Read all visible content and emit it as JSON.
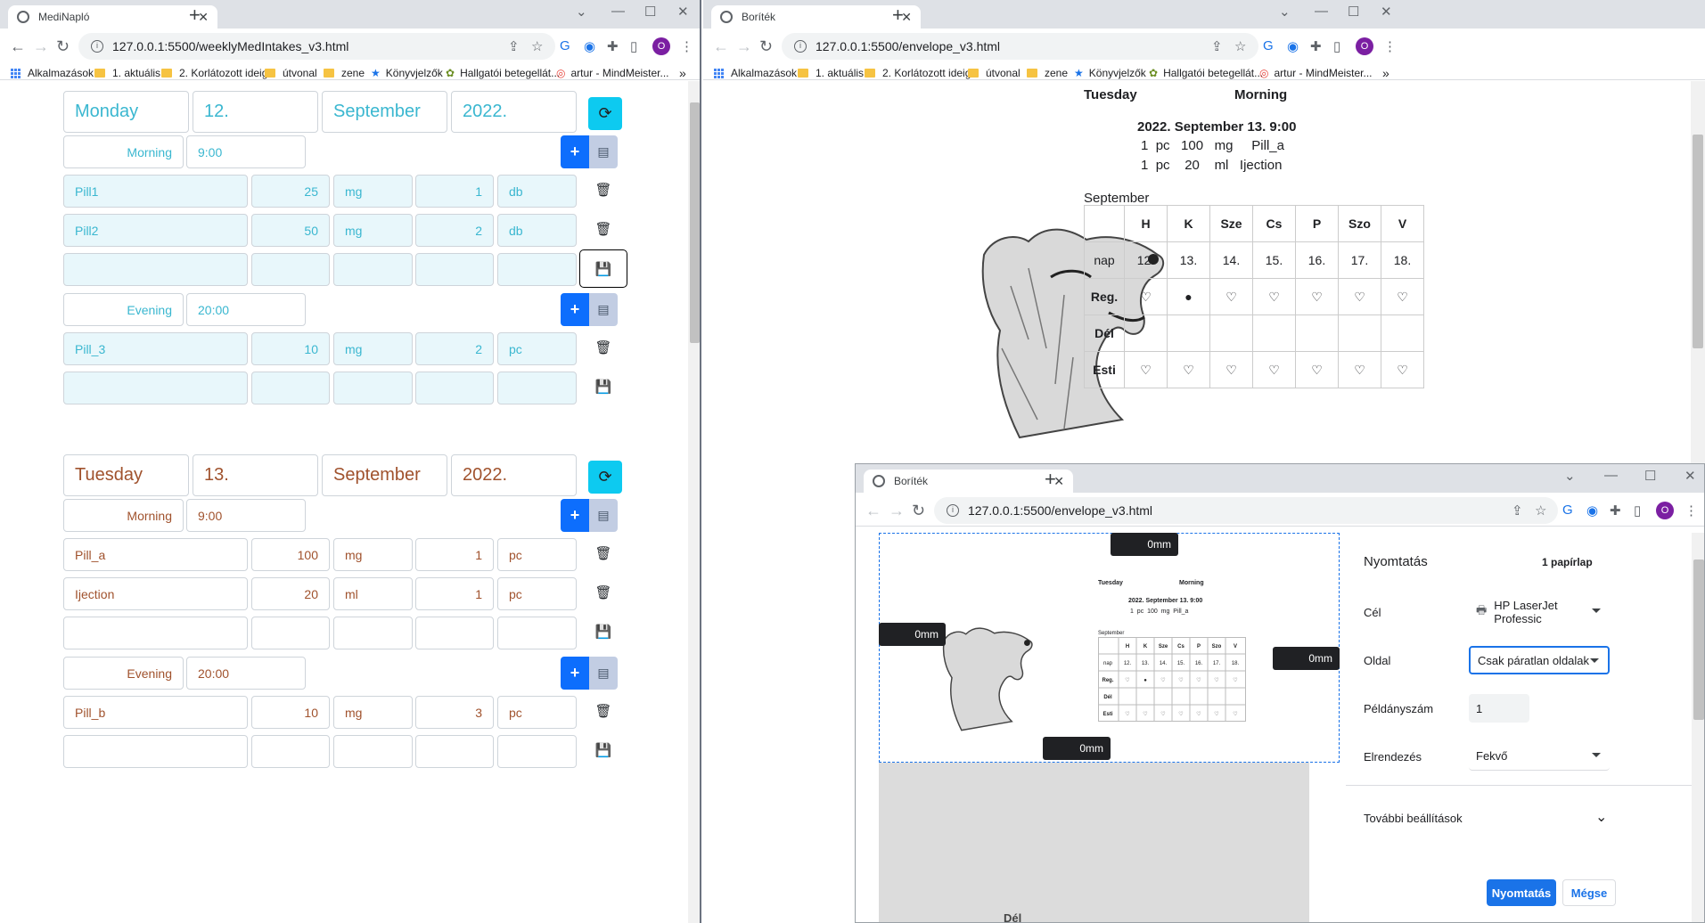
{
  "left_window": {
    "tab_title": "MediNapló",
    "url": "127.0.0.1:5500/weeklyMedIntakes_v3.html",
    "bookmarks": [
      "Alkalmazások",
      "1. aktuális",
      "2. Korlátozott ideig",
      "útvonal",
      "zene",
      "Könyvjelzők",
      "Hallgatói betegellát...",
      "artur - MindMeister..."
    ],
    "days": [
      {
        "day": "Monday",
        "date": "12.",
        "month": "September",
        "year": "2022.",
        "slots": [
          {
            "name": "Morning",
            "time": "9:00",
            "rows": [
              {
                "pill": "Pill1",
                "dose": "25",
                "unit": "mg",
                "qty": "1",
                "qunit": "db"
              },
              {
                "pill": "Pill2",
                "dose": "50",
                "unit": "mg",
                "qty": "2",
                "qunit": "db"
              }
            ]
          },
          {
            "name": "Evening",
            "time": "20:00",
            "rows": [
              {
                "pill": "Pill_3",
                "dose": "10",
                "unit": "mg",
                "qty": "2",
                "qunit": "pc"
              }
            ]
          }
        ]
      },
      {
        "day": "Tuesday",
        "date": "13.",
        "month": "September",
        "year": "2022.",
        "slots": [
          {
            "name": "Morning",
            "time": "9:00",
            "rows": [
              {
                "pill": "Pill_a",
                "dose": "100",
                "unit": "mg",
                "qty": "1",
                "qunit": "pc"
              },
              {
                "pill": "Ijection",
                "dose": "20",
                "unit": "ml",
                "qty": "1",
                "qunit": "pc"
              }
            ]
          },
          {
            "name": "Evening",
            "time": "20:00",
            "rows": [
              {
                "pill": "Pill_b",
                "dose": "10",
                "unit": "mg",
                "qty": "3",
                "qunit": "pc"
              }
            ]
          }
        ]
      }
    ]
  },
  "envelope": {
    "tab_title": "Boríték",
    "url": "127.0.0.1:5500/envelope_v3.html",
    "day": "Tuesday",
    "period": "Morning",
    "datetime": "2022. September 13. 9:00",
    "lines": [
      {
        "qty": "1",
        "qunit": "pc",
        "dose": "100",
        "unit": "mg",
        "name": "Pill_a"
      },
      {
        "qty": "1",
        "qunit": "pc",
        "dose": "20",
        "unit": "ml",
        "name": "Ijection"
      }
    ],
    "month": "September",
    "cal_headers": [
      "H",
      "K",
      "Sze",
      "Cs",
      "P",
      "Szo",
      "V"
    ],
    "cal_row_labels": [
      "nap",
      "Reg.",
      "Dél",
      "Esti"
    ],
    "cal_dates": [
      "12.",
      "13.",
      "14.",
      "15.",
      "16.",
      "17.",
      "18."
    ]
  },
  "print_window": {
    "tab_title": "Boríték",
    "url": "127.0.0.1:5500/envelope_v3.html",
    "margin_label": "0mm",
    "preview_lines": [
      "1",
      "pc",
      "100",
      "mg",
      "Pill_a"
    ],
    "title": "Nyomtatás",
    "sheets": "1 papírlap",
    "dest_label": "Cél",
    "dest_value": "HP LaserJet Professic",
    "pages_label": "Oldal",
    "pages_value": "Csak páratlan oldalak",
    "copies_label": "Példányszám",
    "copies_value": "1",
    "layout_label": "Elrendezés",
    "layout_value": "Fekvő",
    "more_label": "További beállítások",
    "print_btn": "Nyomtatás",
    "cancel_btn": "Mégse",
    "bottom_peek": "Dél"
  },
  "colors": {
    "cyan": "#3ab7d0",
    "brown": "#a0522d",
    "primary": "#0d6efd",
    "info": "#0dcaf0",
    "print_blue": "#1a73e8"
  }
}
